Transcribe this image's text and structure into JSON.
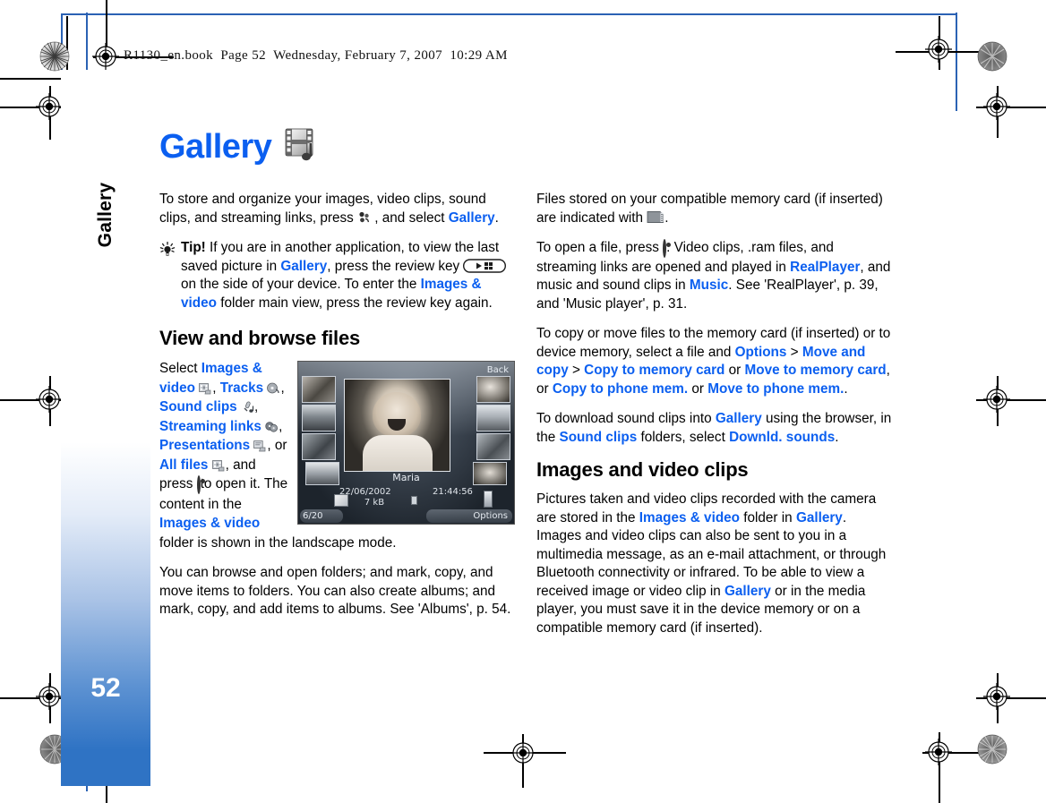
{
  "running_head": "R1130_en.book  Page 52  Wednesday, February 7, 2007  10:29 AM",
  "sidebar": {
    "chapter_label": "Gallery",
    "page_number": "52",
    "gradient_top": "#ffffff",
    "gradient_bottom": "#2f73c4"
  },
  "accent_color": "#0b5ff0",
  "title": {
    "text": "Gallery",
    "icon": "filmstrip-music-note-icon"
  },
  "left_column": {
    "intro": {
      "part1": "To store and organize your images, video clips, sound clips, and streaming links, press ",
      "icon": "menu-key-icon",
      "part2": " , and select ",
      "link": "Gallery",
      "part3": "."
    },
    "tip": {
      "icon": "lightbulb-tip-icon",
      "label": "Tip!",
      "part1": " If you are in another application, to view the last saved picture in ",
      "link1": "Gallery",
      "part2": ", press the review key ",
      "key_icon": "review-key-icon",
      "part3": " on the side of your device. To enter the ",
      "link2": "Images & video",
      "part4": " folder main view, press the review key again."
    },
    "heading": "View and browse files",
    "select_para": {
      "p1": "Select ",
      "l1": "Images & video",
      "i1": "images-video-folder-icon",
      "p2": ", ",
      "l2": "Tracks",
      "i2": "tracks-disc-icon",
      "p3": ", ",
      "l3": "Sound clips",
      "i3": "sound-clips-mic-icon",
      "p4": ", ",
      "l4": "Streaming links",
      "i4": "streaming-links-icon",
      "p5": ", ",
      "l5": "Presentations",
      "i5": "presentations-folder-icon",
      "p6": ", or ",
      "l6": "All files",
      "i6": "all-files-folder-icon",
      "p7": ", and press ",
      "i7": "scroll-key-icon",
      "p8": " to open it. The content in the ",
      "l7": "Images & video",
      "p9": " folder is shown in the landscape mode."
    },
    "browse_para": "You can browse and open folders; and mark, copy, and move items to folders. You can also create albums; and mark, copy, and add items to albums. See 'Albums', p. 54."
  },
  "device_screenshot": {
    "back_label": "Back",
    "image_name": "Maria",
    "date": "22/06/2002",
    "time": "21:44:56",
    "file_size": "7 kB",
    "counter": "6/20",
    "options_label": "Options",
    "thumbnail_count": 8
  },
  "right_column": {
    "memcard_para": {
      "p1": "Files stored on your compatible memory card (if inserted) are indicated with ",
      "icon": "memory-card-icon",
      "p2": "."
    },
    "open_para": {
      "p1": "To open a file, press ",
      "icon": "scroll-key-icon",
      "p2": ". Video clips, .ram files, and streaming links are opened and played in ",
      "l1": "RealPlayer",
      "p3": ", and music and sound clips in ",
      "l2": "Music",
      "p4": ". See 'RealPlayer', p. 39, and 'Music player', p. 31."
    },
    "copy_para": {
      "p1": "To copy or move files to the memory card (if inserted) or to device memory, select a file and ",
      "l1": "Options",
      "p2": " > ",
      "l2": "Move and copy",
      "p3": " > ",
      "l3": "Copy to memory card",
      "p4": " or ",
      "l4": "Move to memory card",
      "p5": ", or ",
      "l5": "Copy to phone mem.",
      "p6": " or ",
      "l6": "Move to phone mem.",
      "p7": "."
    },
    "download_para": {
      "p1": "To download sound clips into ",
      "l1": "Gallery",
      "p2": " using the browser, in the ",
      "l2": "Sound clips",
      "p3": " folders, select ",
      "l3": "Downld. sounds",
      "p4": "."
    },
    "heading": "Images and video clips",
    "images_para": {
      "p1": "Pictures taken and video clips recorded with the camera are stored in the ",
      "l1": "Images & video",
      "p2": " folder in ",
      "l2": "Gallery",
      "p3": ". Images and video clips can also be sent to you in a multimedia message, as an e-mail attachment,  or through Bluetooth connectivity or infrared. To be able to view a received image or video clip in ",
      "l3": "Gallery",
      "p4": " or in the media player, you must save it in the device memory or on a compatible memory card (if inserted)."
    }
  }
}
